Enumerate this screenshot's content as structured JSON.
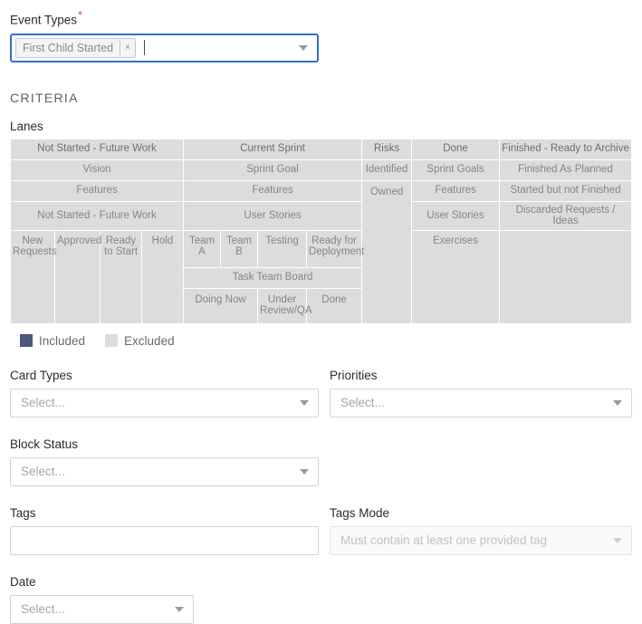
{
  "event_types": {
    "label": "Event Types",
    "required_marker": "*",
    "chips": [
      {
        "label": "First Child Started",
        "remove_icon": "close-icon",
        "remove_glyph": "×"
      }
    ],
    "dropdown_icon": "chevron-down-icon"
  },
  "criteria": {
    "heading": "CRITERIA",
    "lanes_label": "Lanes"
  },
  "lanes": {
    "row1": [
      {
        "text": "Not Started - Future Work"
      },
      {
        "text": "Current Sprint"
      },
      {
        "text": "Risks"
      },
      {
        "text": "Done"
      },
      {
        "text": "Finished - Ready to Archive"
      }
    ],
    "row2": [
      {
        "text": "Vision"
      },
      {
        "text": "Sprint Goal"
      },
      {
        "text": "Identified"
      },
      {
        "text": "Sprint Goals"
      },
      {
        "text": "Finished As Planned"
      }
    ],
    "row3": [
      {
        "text": "Features"
      },
      {
        "text": "Features"
      },
      {
        "text": "Owned"
      },
      {
        "text": "Features"
      },
      {
        "text": "Started but not Finished"
      }
    ],
    "row4": [
      {
        "text": "Not Started - Future Work"
      },
      {
        "text": "User Stories"
      },
      {
        "text": "User Stories"
      },
      {
        "text": "Discarded Requests / Ideas"
      }
    ],
    "row5": [
      {
        "text": "New Requests"
      },
      {
        "text": "Approved"
      },
      {
        "text": "Ready to Start"
      },
      {
        "text": "Hold"
      },
      {
        "text": "Team A"
      },
      {
        "text": "Team B"
      },
      {
        "text": "Testing"
      },
      {
        "text": "Ready for Deployment"
      },
      {
        "text": "Exercises"
      }
    ],
    "row6": [
      {
        "text": "Task Team Board"
      }
    ],
    "row7": [
      {
        "text": "Doing Now"
      },
      {
        "text": "Under Review/QA"
      },
      {
        "text": "Done"
      }
    ]
  },
  "legend": {
    "included": {
      "label": "Included",
      "color": "#4b5878"
    },
    "excluded": {
      "label": "Excluded",
      "color": "#dcdcdc"
    }
  },
  "fields": {
    "card_types": {
      "label": "Card Types",
      "value": "Select...",
      "icon": "chevron-down-icon"
    },
    "priorities": {
      "label": "Priorities",
      "value": "Select...",
      "icon": "chevron-down-icon"
    },
    "block_status": {
      "label": "Block Status",
      "value": "Select...",
      "icon": "chevron-down-icon"
    },
    "tags": {
      "label": "Tags",
      "value": "",
      "placeholder": ""
    },
    "tags_mode": {
      "label": "Tags Mode",
      "value": "Must contain at least one provided tag",
      "icon": "chevron-down-icon",
      "disabled": true
    },
    "date": {
      "label": "Date",
      "value": "Select...",
      "icon": "chevron-down-icon"
    }
  }
}
